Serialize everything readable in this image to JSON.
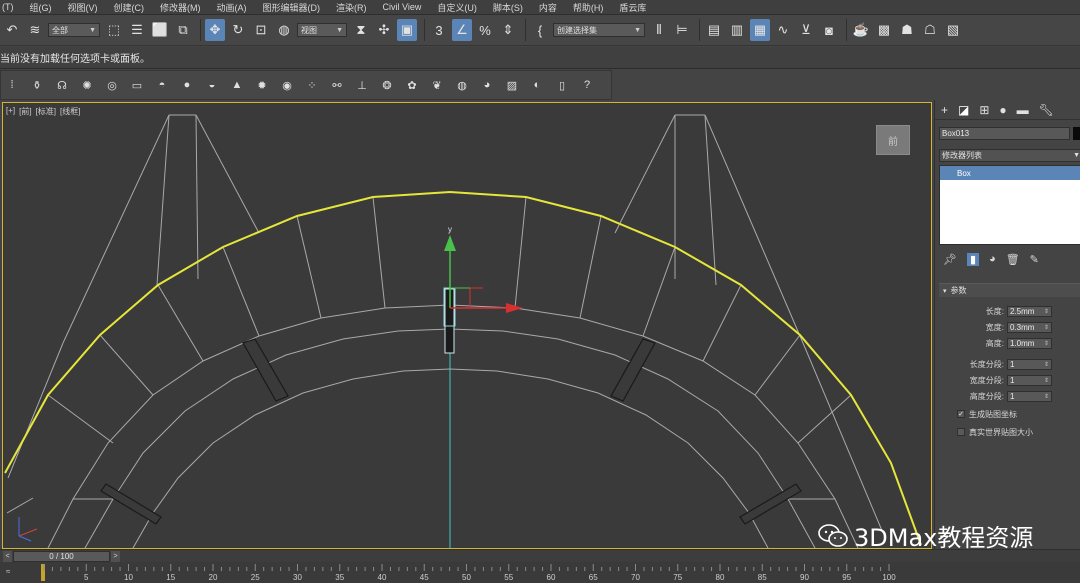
{
  "menubar": {
    "items": [
      "(T)",
      "组(G)",
      "视图(V)",
      "创建(C)",
      "修改器(M)",
      "动画(A)",
      "图形编辑器(D)",
      "渲染(R)",
      "Civil View",
      "自定义(U)",
      "脚本(S)",
      "内容",
      "帮助(H)",
      "盾云库"
    ]
  },
  "maintoolbar": {
    "selection_filter": "全部",
    "reference_coord": "视图",
    "named_selection": "创建选择集"
  },
  "ribbon": {
    "message": "当前没有加载任何选项卡或面板。"
  },
  "viewport": {
    "labels": [
      "[+]",
      "[前]",
      "[标准]",
      "[线框]"
    ],
    "viewcube_label": "前"
  },
  "command_panel": {
    "object_name": "Box013",
    "object_color": "#0a0a0a",
    "modifier_list_label": "修改器列表",
    "stack_items": [
      "Box"
    ],
    "rollout_title": "参数",
    "params": [
      {
        "label": "长度:",
        "value": "2.5mm"
      },
      {
        "label": "宽度:",
        "value": "0.3mm"
      },
      {
        "label": "高度:",
        "value": "1.0mm"
      },
      {
        "label": "长度分段:",
        "value": "1"
      },
      {
        "label": "宽度分段:",
        "value": "1"
      },
      {
        "label": "高度分段:",
        "value": "1"
      }
    ],
    "checks": [
      {
        "label": "生成贴图坐标",
        "checked": true
      },
      {
        "label": "真实世界贴图大小",
        "checked": false
      }
    ]
  },
  "timeline": {
    "frame_display": "0 / 100",
    "prev": "<",
    "next": ">",
    "ticks": [
      "5",
      "10",
      "15",
      "20",
      "25",
      "30",
      "35",
      "40",
      "45",
      "50",
      "55",
      "60",
      "65",
      "70",
      "75",
      "80",
      "85",
      "90",
      "95",
      "100"
    ]
  },
  "watermark": {
    "text": "3DMax教程资源"
  },
  "colors": {
    "accent": "#5b85b7",
    "viewport_border": "#d3b530",
    "selected_spline": "#e6e63a",
    "wireframe": "#a9a9a9"
  }
}
